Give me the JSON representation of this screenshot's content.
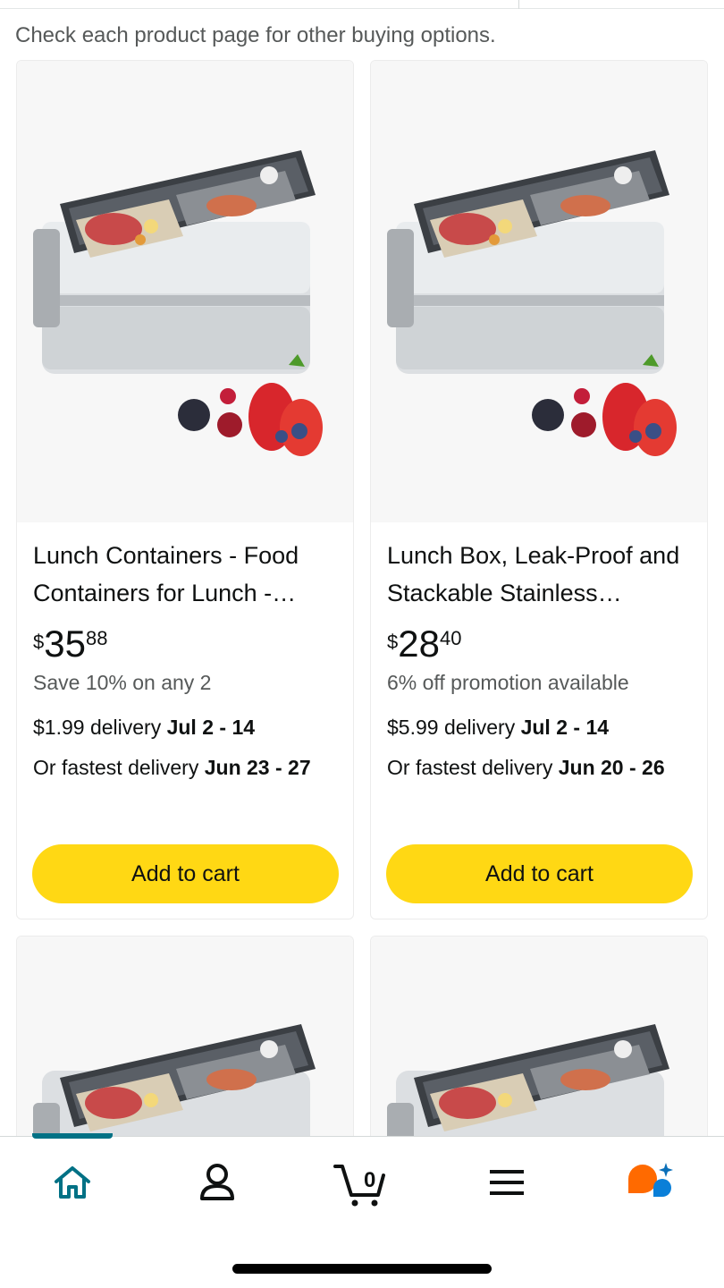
{
  "notice": "Check each product page for other buying options.",
  "products": [
    {
      "title": "Lunch Containers - Food Containers for Lunch -…",
      "price_symbol": "$",
      "price_whole": "35",
      "price_fraction": "88",
      "promo": "Save 10% on any 2",
      "delivery_prefix": "$1.99 delivery ",
      "delivery_dates": "Jul 2 - 14",
      "fastest_prefix": "Or fastest delivery ",
      "fastest_dates": "Jun 23 - 27",
      "button": "Add to cart"
    },
    {
      "title": "Lunch Box, Leak-Proof and Stackable Stainless…",
      "price_symbol": "$",
      "price_whole": "28",
      "price_fraction": "40",
      "promo": "6% off promotion available",
      "delivery_prefix": "$5.99 delivery ",
      "delivery_dates": "Jul 2 - 14",
      "fastest_prefix": "Or fastest delivery ",
      "fastest_dates": "Jun 20 - 26",
      "button": "Add to cart"
    }
  ],
  "nav": {
    "items": [
      "home-icon",
      "account-icon",
      "cart-icon",
      "menu-icon",
      "rufus-assistant-icon"
    ],
    "active": "home",
    "cart_count": "0"
  },
  "colors": {
    "accent": "#007185",
    "button": "#ffd814",
    "assistant_orange": "#ff6a00",
    "assistant_blue": "#0a7fd8"
  }
}
